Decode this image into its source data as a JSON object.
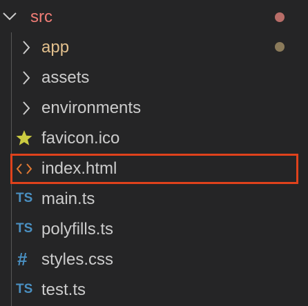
{
  "root": {
    "name": "src",
    "color": "#f07d76",
    "badge_color": "#b86d68"
  },
  "items": [
    {
      "name": "app",
      "kind": "folder",
      "icon": "chevron-right-icon",
      "color": "#e2c08d",
      "badge_color": "#8a7a5a"
    },
    {
      "name": "assets",
      "kind": "folder",
      "icon": "chevron-right-icon",
      "color": "#cccccc"
    },
    {
      "name": "environments",
      "kind": "folder",
      "icon": "chevron-right-icon",
      "color": "#cccccc"
    },
    {
      "name": "favicon.ico",
      "kind": "file",
      "icon": "star-icon",
      "color": "#cccccc",
      "icon_color": "#cbcb41"
    },
    {
      "name": "index.html",
      "kind": "file",
      "icon": "html-code-icon",
      "color": "#cccccc",
      "icon_color": "#e37933",
      "highlighted": true
    },
    {
      "name": "main.ts",
      "kind": "file",
      "icon": "typescript-icon",
      "icon_text": "TS",
      "color": "#cccccc"
    },
    {
      "name": "polyfills.ts",
      "kind": "file",
      "icon": "typescript-icon",
      "icon_text": "TS",
      "color": "#cccccc"
    },
    {
      "name": "styles.css",
      "kind": "file",
      "icon": "css-hash-icon",
      "icon_text": "#",
      "color": "#cccccc"
    },
    {
      "name": "test.ts",
      "kind": "file",
      "icon": "typescript-icon",
      "icon_text": "TS",
      "color": "#cccccc"
    }
  ],
  "highlight_color": "#e0421c",
  "background": "#252526"
}
